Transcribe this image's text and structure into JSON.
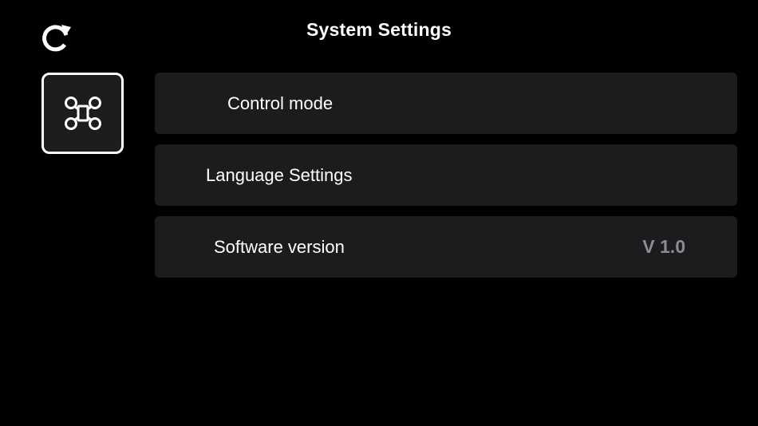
{
  "header": {
    "title": "System Settings",
    "refresh_icon": "refresh-icon"
  },
  "sidebar": {
    "active_tab_icon": "drone-icon"
  },
  "settings": {
    "items": [
      {
        "label": "Control mode"
      },
      {
        "label": "Language Settings"
      },
      {
        "label": "Software version",
        "value": "V 1.0"
      }
    ]
  },
  "colors": {
    "background": "#000000",
    "row_background": "#1b1c1e",
    "text": "#ffffff",
    "value_text": "#8b8c8f"
  }
}
